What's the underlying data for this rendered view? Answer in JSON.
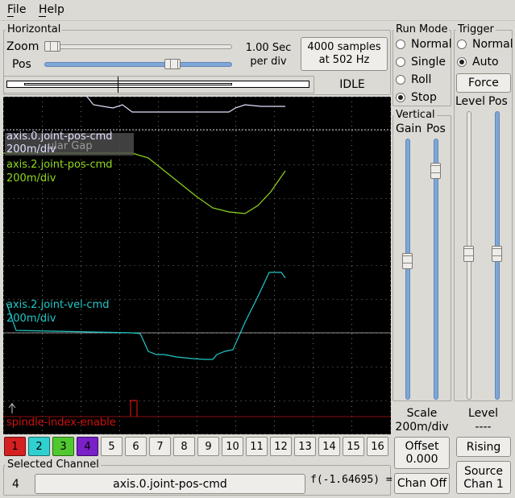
{
  "menu": {
    "file": "File",
    "help": "Help"
  },
  "horizontal": {
    "title": "Horizontal",
    "zoom_label": "Zoom",
    "pos_label": "Pos",
    "zoom_value": "1.00 Sec\nper div",
    "samples": "4000 samples\nat 502 Hz",
    "state": "IDLE"
  },
  "run_mode": {
    "title": "Run Mode",
    "options": [
      "Normal",
      "Single",
      "Roll",
      "Stop"
    ],
    "selected": "Stop"
  },
  "trigger": {
    "title": "Trigger",
    "options": [
      "Normal",
      "Auto"
    ],
    "selected": "Auto",
    "force_label": "Force",
    "level_label": "Level",
    "pos_label": "Pos",
    "bottom_level_title": "Level",
    "bottom_level_value": "----",
    "rising_label": "Rising",
    "source_label": "Source\nChan  1"
  },
  "vertical": {
    "title": "Vertical",
    "gain_label": "Gain",
    "pos_label": "Pos",
    "scale_title": "Scale",
    "scale_value": "200m/div",
    "offset_label": "Offset\n0.000",
    "chan_off_label": "Chan Off"
  },
  "scope": {
    "traces": [
      {
        "name": "axis.0.joint-pos-cmd",
        "scale": "200m/div",
        "color": "#e0e0ff"
      },
      {
        "name": "axis.2.joint-pos-cmd",
        "scale": "200m/div",
        "color": "#8fd81e"
      },
      {
        "name": "axis.2.joint-vel-cmd",
        "scale": "200m/div",
        "color": "#20c8c8"
      },
      {
        "name": "spindle-index-enable",
        "scale": "",
        "color": "#d01010"
      }
    ],
    "overlay_text": "ular Gap"
  },
  "channels": {
    "buttons": [
      "1",
      "2",
      "3",
      "4",
      "5",
      "6",
      "7",
      "8",
      "9",
      "10",
      "11",
      "12",
      "13",
      "14",
      "15",
      "16"
    ],
    "colors": [
      "#d42020",
      "#30d0d0",
      "#50c830",
      "#7a20c8"
    ]
  },
  "selected_channel": {
    "title": "Selected Channel",
    "number": "4",
    "name": "axis.0.joint-pos-cmd",
    "value": "f(-1.64695) ="
  }
}
